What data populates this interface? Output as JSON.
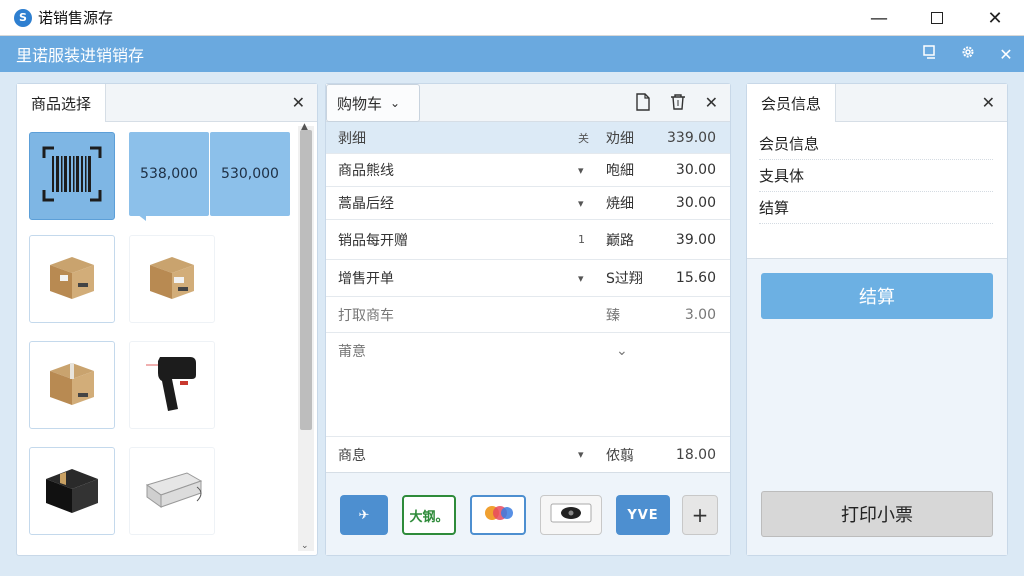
{
  "window": {
    "title": "诺销售源存",
    "app_icon_letter": "S",
    "minimize": "—",
    "close": "✕"
  },
  "header": {
    "title": "里诺服装进销销存",
    "icons": [
      "monitor-icon",
      "gear-icon",
      "close-icon"
    ]
  },
  "product_panel": {
    "tab_label": "商品选择",
    "close": "✕",
    "price_tiles": [
      "538,000",
      "530,000"
    ],
    "tiles": [
      "barcode-icon",
      "box-icon",
      "box-icon",
      "box-icon",
      "barcode-scanner-icon",
      "black-box-icon",
      "printer-icon"
    ],
    "scroll_up": "▲",
    "scroll_down": "⌄"
  },
  "cart_panel": {
    "dropdown_label": "购物车",
    "dropdown_chevron": "⌄",
    "tools": [
      "document-icon",
      "clear-cart-icon",
      "close-icon"
    ],
    "header": {
      "name": "剥细",
      "mark": "关",
      "qty": "劝细",
      "amount": "339.00"
    },
    "rows": [
      {
        "name": "商品熊线",
        "mark": "▾",
        "qty": "咆細",
        "amount": "30.00"
      },
      {
        "name": "蒿晶后经",
        "mark": "▾",
        "qty": "焼细",
        "amount": "30.00"
      },
      {
        "name": "销品每开赠",
        "mark": "1",
        "qty": "巅路",
        "amount": "39.00"
      },
      {
        "name": "增售开单",
        "mark": "▾",
        "qty": "S过翔",
        "amount": "15.60"
      },
      {
        "name": "打取商车",
        "mark": "",
        "qty": "臻",
        "amount": "3.00"
      },
      {
        "name": "莆意",
        "mark": "⌄",
        "qty": "",
        "amount": ""
      }
    ],
    "summary": {
      "name": "商息",
      "mark": "▾",
      "qty": "侬翦",
      "amount": "18.00"
    },
    "payment_methods": [
      {
        "label": "✈",
        "bg": "#4d8fd0",
        "fg": "#ffffff",
        "name": "payment-airplane"
      },
      {
        "label": "大钢。",
        "bg": "#ffffff",
        "fg": "#2e8b3a",
        "name": "payment-wechat"
      },
      {
        "label": "●●",
        "bg": "#ffffff",
        "fg": "#e85a3c",
        "name": "payment-card"
      },
      {
        "label": "◉",
        "bg": "#f6f6f6",
        "fg": "#333333",
        "name": "payment-eye"
      },
      {
        "label": "YVE",
        "bg": "#4d8fd0",
        "fg": "#ffffff",
        "name": "payment-yve"
      }
    ],
    "add_label": "+"
  },
  "member_panel": {
    "tab_label": "会员信息",
    "close": "✕",
    "items": [
      "会员信息",
      "支具体",
      "结算"
    ],
    "checkout_label": "结算",
    "print_label": "打印小票"
  }
}
